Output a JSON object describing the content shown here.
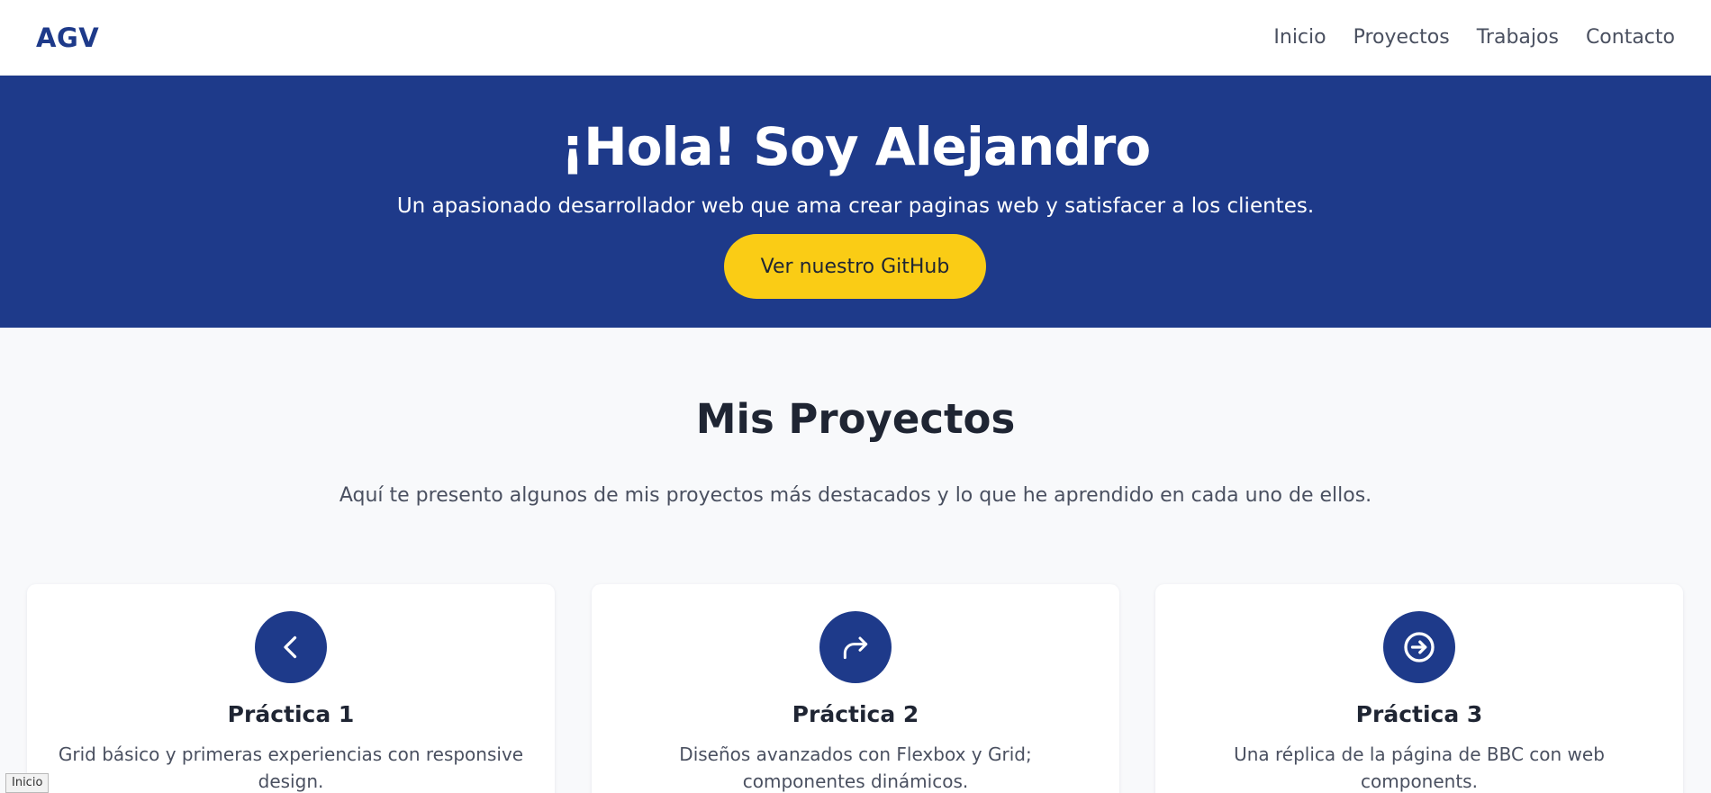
{
  "nav": {
    "brand": "AGV",
    "links": [
      "Inicio",
      "Proyectos",
      "Trabajos",
      "Contacto"
    ]
  },
  "hero": {
    "title": "¡Hola! Soy Alejandro",
    "subtitle": "Un apasionado desarrollador web que ama crear paginas web y satisfacer a los clientes.",
    "button_label": "Ver nuestro GitHub"
  },
  "projects": {
    "title": "Mis Proyectos",
    "intro": "Aquí te presento algunos de mis proyectos más destacados y lo que he aprendido en cada uno de ellos.",
    "cards": [
      {
        "icon": "chevron-left-icon",
        "title": "Práctica 1",
        "description": "Grid básico y primeras experiencias con responsive design."
      },
      {
        "icon": "share-arrow-icon",
        "title": "Práctica 2",
        "description": "Diseños avanzados con Flexbox y Grid; componentes dinámicos."
      },
      {
        "icon": "arrow-circle-right-icon",
        "title": "Práctica 3",
        "description": "Una réplica de la página de BBC con web components."
      }
    ]
  },
  "status_tooltip": "Inicio",
  "colors": {
    "primary": "#1e3a8a",
    "accent": "#facc15",
    "background": "#f8f9fb"
  }
}
